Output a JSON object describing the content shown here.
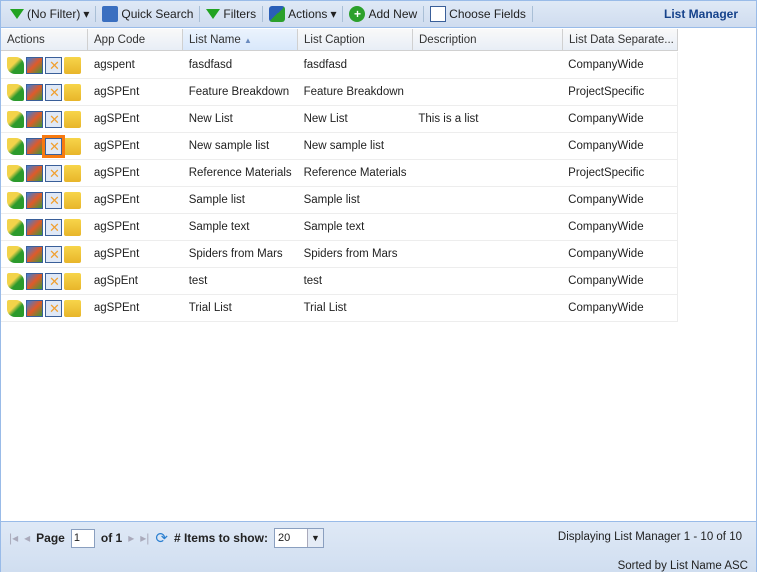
{
  "toolbar": {
    "filter": "(No Filter)",
    "quick_search": "Quick Search",
    "filters": "Filters",
    "actions": "Actions",
    "add_new": "Add New",
    "choose_fields": "Choose Fields",
    "title": "List Manager"
  },
  "columns": [
    "Actions",
    "App Code",
    "List Name",
    "List Caption",
    "Description",
    "List Data Separate..."
  ],
  "rows": [
    {
      "app": "agspent",
      "name": "fasdfasd",
      "caption": "fasdfasd",
      "desc": "",
      "sep": "CompanyWide"
    },
    {
      "app": "agSPEnt",
      "name": "Feature Breakdown",
      "caption": "Feature Breakdown",
      "desc": "",
      "sep": "ProjectSpecific"
    },
    {
      "app": "agSPEnt",
      "name": "New List",
      "caption": "New List",
      "desc": "This is a list",
      "sep": "CompanyWide"
    },
    {
      "app": "agSPEnt",
      "name": "New sample list",
      "caption": "New sample list",
      "desc": "",
      "sep": "CompanyWide"
    },
    {
      "app": "agSPEnt",
      "name": "Reference Materials",
      "caption": "Reference Materials",
      "desc": "",
      "sep": "ProjectSpecific"
    },
    {
      "app": "agSPEnt",
      "name": "Sample list",
      "caption": "Sample list",
      "desc": "",
      "sep": "CompanyWide"
    },
    {
      "app": "agSPEnt",
      "name": "Sample text",
      "caption": "Sample text",
      "desc": "",
      "sep": "CompanyWide"
    },
    {
      "app": "agSPEnt",
      "name": "Spiders from Mars",
      "caption": "Spiders from Mars",
      "desc": "",
      "sep": "CompanyWide"
    },
    {
      "app": "agSpEnt",
      "name": "test",
      "caption": "test",
      "desc": "",
      "sep": "CompanyWide"
    },
    {
      "app": "agSPEnt",
      "name": "Trial List",
      "caption": "Trial List",
      "desc": "",
      "sep": "CompanyWide"
    }
  ],
  "pager": {
    "page_label": "Page",
    "page": "1",
    "of": "of 1",
    "items_label": "# Items to show:",
    "items": "20",
    "display": "Displaying List Manager 1 - 10 of 10",
    "sorted": "Sorted by List Name ASC"
  }
}
